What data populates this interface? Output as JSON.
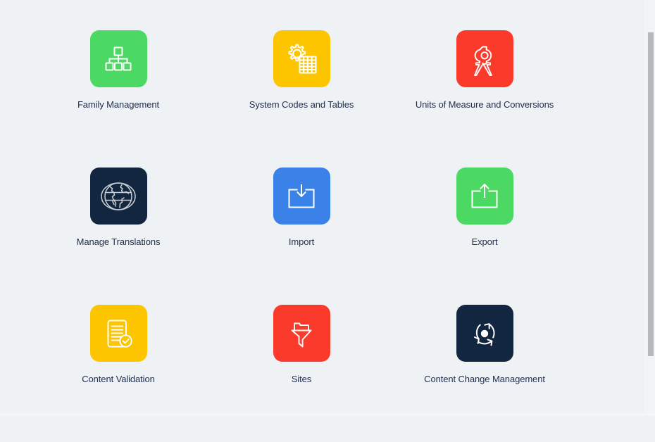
{
  "page": {
    "background_color": "#eff2f5",
    "label_color": "#1f2d4a"
  },
  "scrollbar": {
    "name": "vertical-scrollbar",
    "track_color": "#f2f4f6",
    "thumb_color": "#b8b8b8"
  },
  "tiles": [
    {
      "id": "family-management",
      "label": "Family Management",
      "icon": "hierarchy-icon",
      "color": "#4bd863"
    },
    {
      "id": "system-codes-and-tables",
      "label": "System Codes and Tables",
      "icon": "gear-table-icon",
      "color": "#fdc500"
    },
    {
      "id": "units-of-measure-and-conversions",
      "label": "Units of Measure and Conversions",
      "icon": "compass-icon",
      "color": "#fa3b2c"
    },
    {
      "id": "manage-translations",
      "label": "Manage Translations",
      "icon": "globe-icon",
      "color": "#12263f"
    },
    {
      "id": "import",
      "label": "Import",
      "icon": "import-arrow-icon",
      "color": "#3b82e8"
    },
    {
      "id": "export",
      "label": "Export",
      "icon": "export-arrow-icon",
      "color": "#4bd863"
    },
    {
      "id": "content-validation",
      "label": "Content Validation",
      "icon": "document-check-icon",
      "color": "#fdc500"
    },
    {
      "id": "sites",
      "label": "Sites",
      "icon": "funnel-folder-icon",
      "color": "#fa3b2c"
    },
    {
      "id": "content-change-management",
      "label": "Content Change Management",
      "icon": "refresh-cycle-icon",
      "color": "#12263f"
    }
  ]
}
